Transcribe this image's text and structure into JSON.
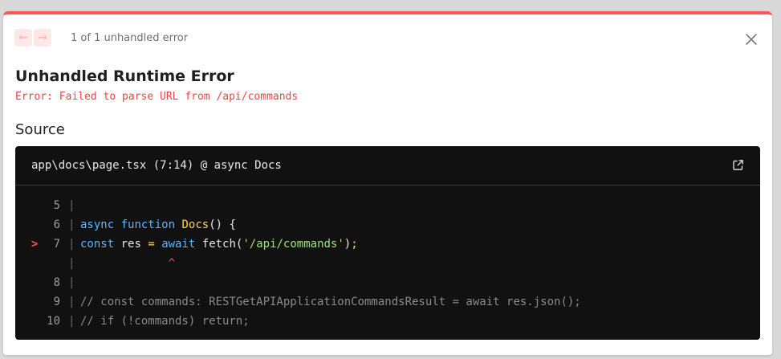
{
  "nav": {
    "prev_label": "←",
    "next_label": "→",
    "pager_text": "1 of 1 unhandled error"
  },
  "title": "Unhandled Runtime Error",
  "error_message": "Error: Failed to parse URL from /api/commands",
  "source_heading": "Source",
  "code_frame": {
    "file_path": "app\\docs\\page.tsx (7:14) @ async Docs",
    "lines": [
      {
        "number": "5",
        "marker": "",
        "segments": []
      },
      {
        "number": "6",
        "marker": "",
        "segments": [
          {
            "text": "async",
            "kind": "kw"
          },
          {
            "text": " ",
            "kind": "plain"
          },
          {
            "text": "function",
            "kind": "kw"
          },
          {
            "text": " ",
            "kind": "plain"
          },
          {
            "text": "Docs",
            "kind": "fn"
          },
          {
            "text": "() {",
            "kind": "plain"
          }
        ]
      },
      {
        "number": "7",
        "marker": ">",
        "segments": [
          {
            "text": "const",
            "kind": "kw"
          },
          {
            "text": " res ",
            "kind": "plain"
          },
          {
            "text": "=",
            "kind": "fn"
          },
          {
            "text": " ",
            "kind": "plain"
          },
          {
            "text": "await",
            "kind": "kw"
          },
          {
            "text": " fetch(",
            "kind": "plain"
          },
          {
            "text": "'/api/commands'",
            "kind": "str"
          },
          {
            "text": ")",
            "kind": "plain"
          },
          {
            "text": ";",
            "kind": "fn"
          }
        ]
      },
      {
        "number": "",
        "marker": "",
        "segments": [
          {
            "text": "             ^",
            "kind": "caret"
          }
        ]
      },
      {
        "number": "8",
        "marker": "",
        "segments": []
      },
      {
        "number": "9",
        "marker": "",
        "segments": [
          {
            "text": "// const commands: RESTGetAPIApplicationCommandsResult = await res.json();",
            "kind": "cmt"
          }
        ]
      },
      {
        "number": "10",
        "marker": "",
        "segments": [
          {
            "text": "// if (!commands) return;",
            "kind": "cmt"
          }
        ]
      }
    ]
  },
  "colors": {
    "accent_bar": "#ff5555",
    "error_text": "#ef4444",
    "code_bg": "#111111",
    "keyword": "#59b6ff",
    "function": "#ffd35c",
    "string": "#9be77b"
  },
  "icons": {
    "prev": "arrow-left-icon",
    "next": "arrow-right-icon",
    "close": "close-icon",
    "open_in_editor": "external-link-icon"
  }
}
